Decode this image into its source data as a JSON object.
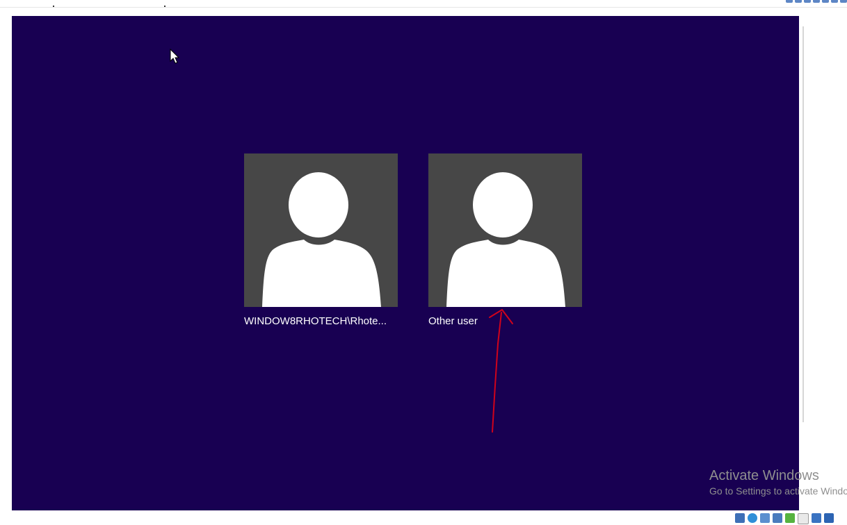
{
  "login_screen": {
    "users": [
      {
        "label": "WINDOW8RHOTECH\\Rhote...",
        "icon": "user-avatar-icon"
      },
      {
        "label": "Other user",
        "icon": "user-avatar-icon"
      }
    ]
  },
  "watermark": {
    "title": "Activate Windows",
    "subtitle": "Go to Settings to activate Windows."
  },
  "colors": {
    "background": "#180052",
    "tile": "#474747",
    "annotation_arrow": "#d0021b",
    "watermark_text": "#8f8f8f"
  },
  "status_icons": [
    "hard-disk-icon",
    "optical-drive-icon",
    "audio-icon",
    "network-icon",
    "usb-icon",
    "shared-folder-icon",
    "display-icon",
    "recording-icon"
  ]
}
